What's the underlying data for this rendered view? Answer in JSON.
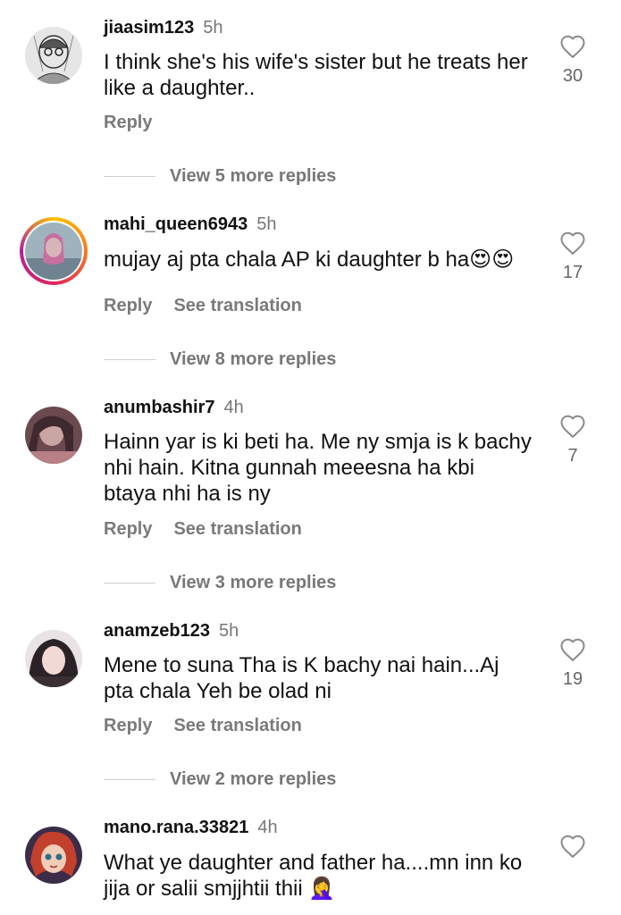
{
  "comments": [
    {
      "username": "jiaasim123",
      "time": "5h",
      "text": "I think she's his wife's sister but he treats her like a daughter..",
      "reply": "Reply",
      "translate": "",
      "likes": "30",
      "view_more": "View 5 more replies",
      "avatar_icon": "sketch-portrait-avatar"
    },
    {
      "username": "mahi_queen6943",
      "time": "5h",
      "text": "mujay aj pta chala AP ki daughter b ha",
      "emoji": "😍😍",
      "reply": "Reply",
      "translate": "See translation",
      "likes": "17",
      "view_more": "View 8 more replies",
      "avatar_icon": "story-ring-avatar"
    },
    {
      "username": "anumbashir7",
      "time": "4h",
      "text": "Hainn  yar is ki beti ha. Me ny smja is k bachy nhi hain. Kitna gunnah meeesna ha kbi btaya nhi ha is ny",
      "reply": "Reply",
      "translate": "See translation",
      "likes": "7",
      "view_more": "View 3 more replies",
      "avatar_icon": "portrait-avatar"
    },
    {
      "username": "anamzeb123",
      "time": "5h",
      "text": "Mene to suna Tha is K bachy nai hain...Aj pta chala Yeh be olad ni",
      "reply": "Reply",
      "translate": "See translation",
      "likes": "19",
      "view_more": "View 2 more replies",
      "avatar_icon": "portrait-avatar"
    },
    {
      "username": "mano.rana.33821",
      "time": "4h",
      "text": "What ye daughter and father ha....mn inn ko jija or salii smjjhtii thii",
      "emoji": "🤦‍♀️",
      "reply": "",
      "translate": "",
      "likes": "",
      "view_more": "",
      "avatar_icon": "doll-avatar"
    }
  ],
  "colors": {
    "text": "#111111",
    "muted": "#777777",
    "story_ring": [
      "#f9c300",
      "#f77a1c",
      "#e0245e",
      "#b51e9e"
    ]
  }
}
